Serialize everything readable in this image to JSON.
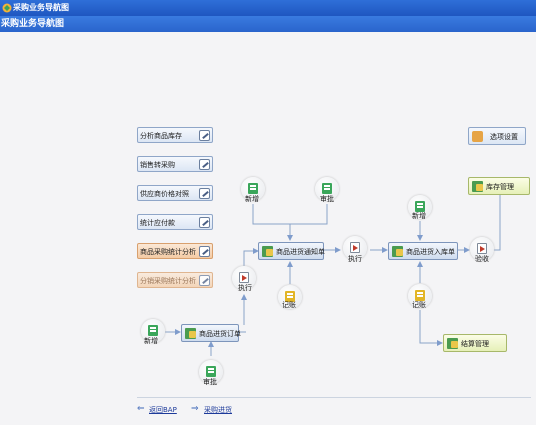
{
  "window": {
    "title": "采购业务导航图"
  },
  "page": {
    "heading": "采购业务导航图"
  },
  "sidebar": {
    "items": [
      {
        "label": "分析商品库存",
        "style": "blue"
      },
      {
        "label": "销售转采购",
        "style": "blue"
      },
      {
        "label": "供应商价格对照",
        "style": "blue"
      },
      {
        "label": "统计应付款",
        "style": "blue"
      },
      {
        "label": "商品采购统计分析",
        "style": "orange"
      },
      {
        "label": "分销采购统计分析",
        "style": "orange-faded"
      }
    ]
  },
  "options": {
    "label": "选项设置"
  },
  "flow": {
    "nodes": {
      "new_notice": "新增",
      "approve_notice": "审批",
      "execute_order": "执行",
      "record_notice": "记账",
      "execute_notice": "执行",
      "new_receipt": "新增",
      "record_receipt": "记账",
      "accept": "验收",
      "new_order": "新增",
      "approve_order": "审批"
    },
    "boxes": {
      "purchase_notice": "商品进货通知单",
      "purchase_receipt": "商品进货入库单",
      "purchase_order": "商品进货订单",
      "inventory_mgmt": "库存管理",
      "settlement_mgmt": "结算管理"
    }
  },
  "footer": {
    "back_link": "返回BAP",
    "purchase_link": "采购进货"
  },
  "colors": {
    "titlebar": "#1f56c0",
    "line": "#8aa3c8",
    "link": "#1d3a9a"
  }
}
